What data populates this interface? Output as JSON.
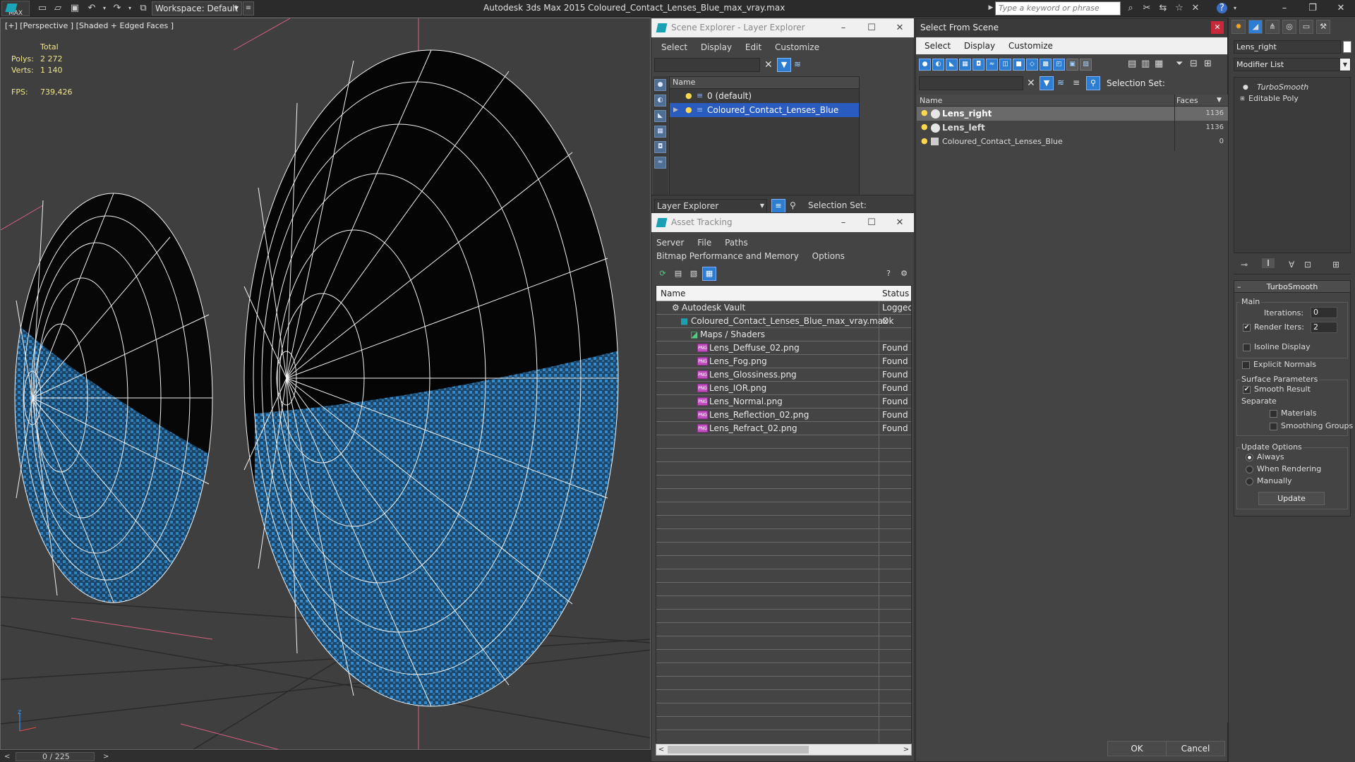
{
  "app": {
    "logo_text": "MAX",
    "workspace": "Workspace: Default",
    "title": "Autodesk 3ds Max  2015    Coloured_Contact_Lenses_Blue_max_vray.max",
    "search_placeholder": "Type a keyword or phrase"
  },
  "viewport": {
    "label": "[+] [Perspective ] [Shaded + Edged Faces ]",
    "stats": {
      "total_label": "Total",
      "polys_label": "Polys:",
      "polys": "2 272",
      "verts_label": "Verts:",
      "verts": "1 140",
      "fps_label": "FPS:",
      "fps": "739,426"
    },
    "time": "0 / 225",
    "axis_z": "z"
  },
  "scene_explorer": {
    "title": "Scene Explorer - Layer Explorer",
    "menu": [
      "Select",
      "Display",
      "Edit",
      "Customize"
    ],
    "column": "Name",
    "rows": [
      {
        "label": "0 (default)"
      },
      {
        "label": "Coloured_Contact_Lenses_Blue"
      }
    ],
    "bottom_label": "Layer Explorer",
    "selection_set": "Selection Set:"
  },
  "asset_tracking": {
    "title": "Asset Tracking",
    "menu": [
      "Server",
      "File",
      "Paths",
      "Bitmap Performance and Memory",
      "Options"
    ],
    "columns": {
      "name": "Name",
      "status": "Status"
    },
    "rows": [
      {
        "name": "Autodesk Vault",
        "status": "Logged"
      },
      {
        "name": "Coloured_Contact_Lenses_Blue_max_vray.max",
        "status": "Ok"
      },
      {
        "name": "Maps / Shaders",
        "status": ""
      },
      {
        "name": "Lens_Deffuse_02.png",
        "status": "Found"
      },
      {
        "name": "Lens_Fog.png",
        "status": "Found"
      },
      {
        "name": "Lens_Glossiness.png",
        "status": "Found"
      },
      {
        "name": "Lens_IOR.png",
        "status": "Found"
      },
      {
        "name": "Lens_Normal.png",
        "status": "Found"
      },
      {
        "name": "Lens_Reflection_02.png",
        "status": "Found"
      },
      {
        "name": "Lens_Refract_02.png",
        "status": "Found"
      }
    ],
    "png_tag": "PNG"
  },
  "select_from_scene": {
    "title": "Select From Scene",
    "menu": [
      "Select",
      "Display",
      "Customize"
    ],
    "selection_set": "Selection Set:",
    "columns": {
      "name": "Name",
      "faces": "Faces"
    },
    "rows": [
      {
        "name": "Lens_right",
        "faces": "1136"
      },
      {
        "name": "Lens_left",
        "faces": "1136"
      },
      {
        "name": "Coloured_Contact_Lenses_Blue",
        "faces": "0"
      }
    ],
    "ok": "OK",
    "cancel": "Cancel"
  },
  "command_panel": {
    "object_name": "Lens_right",
    "modifier_list": "Modifier List",
    "stack": [
      "TurboSmooth",
      "Editable Poly"
    ],
    "rollout_title": "TurboSmooth",
    "main": {
      "group": "Main",
      "iterations_label": "Iterations:",
      "iterations": "0",
      "render_iters_label": "Render Iters:",
      "render_iters": "2",
      "isoline": "Isoline Display",
      "explicit_normals": "Explicit Normals"
    },
    "surface": {
      "group": "Surface Parameters",
      "smooth_result": "Smooth Result",
      "separate": "Separate",
      "materials": "Materials",
      "smoothing_groups": "Smoothing Groups"
    },
    "update": {
      "group": "Update Options",
      "always": "Always",
      "when_rendering": "When Rendering",
      "manually": "Manually",
      "button": "Update"
    }
  },
  "colors": {
    "accent": "#2a5bbf",
    "lens_blue": "#2f86c9",
    "found_text": "#e8e8e8"
  }
}
